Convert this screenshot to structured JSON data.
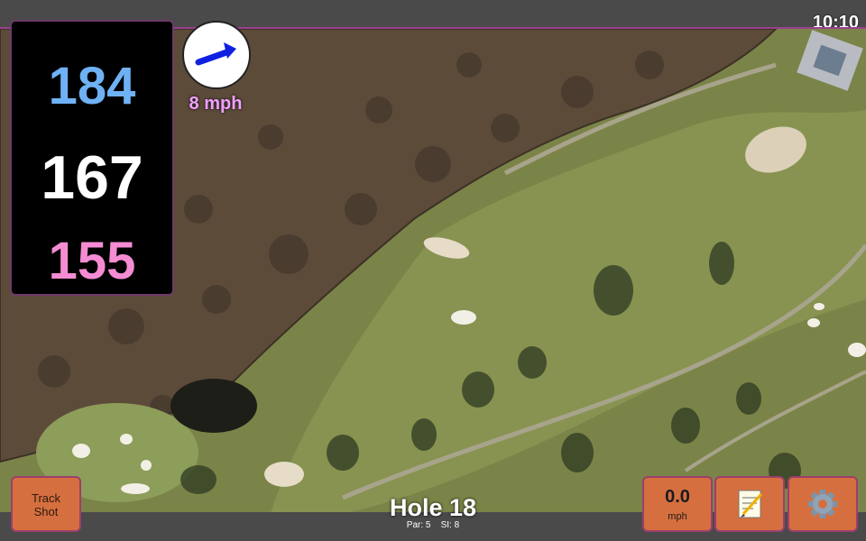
{
  "status_bar": {
    "time": "10:10"
  },
  "yardages": {
    "back": "184",
    "middle": "167",
    "front": "155"
  },
  "wind": {
    "speed": "8 mph",
    "direction_icon": "wind-arrow-icon"
  },
  "track_shot": {
    "line1": "Track",
    "line2": "Shot"
  },
  "speed_button": {
    "value": "0.0",
    "unit": "mph"
  },
  "hole": {
    "title": "Hole 18",
    "par": "Par: 5",
    "si": "SI: 8"
  },
  "icons": {
    "notes": "notepad-icon",
    "settings": "gear-icon"
  },
  "colors": {
    "back_yardage": "#6fb1f5",
    "middle_yardage": "#ffffff",
    "front_yardage": "#f58cd3",
    "button_accent": "#d66f3f",
    "wind_text": "#f0a0ff"
  }
}
